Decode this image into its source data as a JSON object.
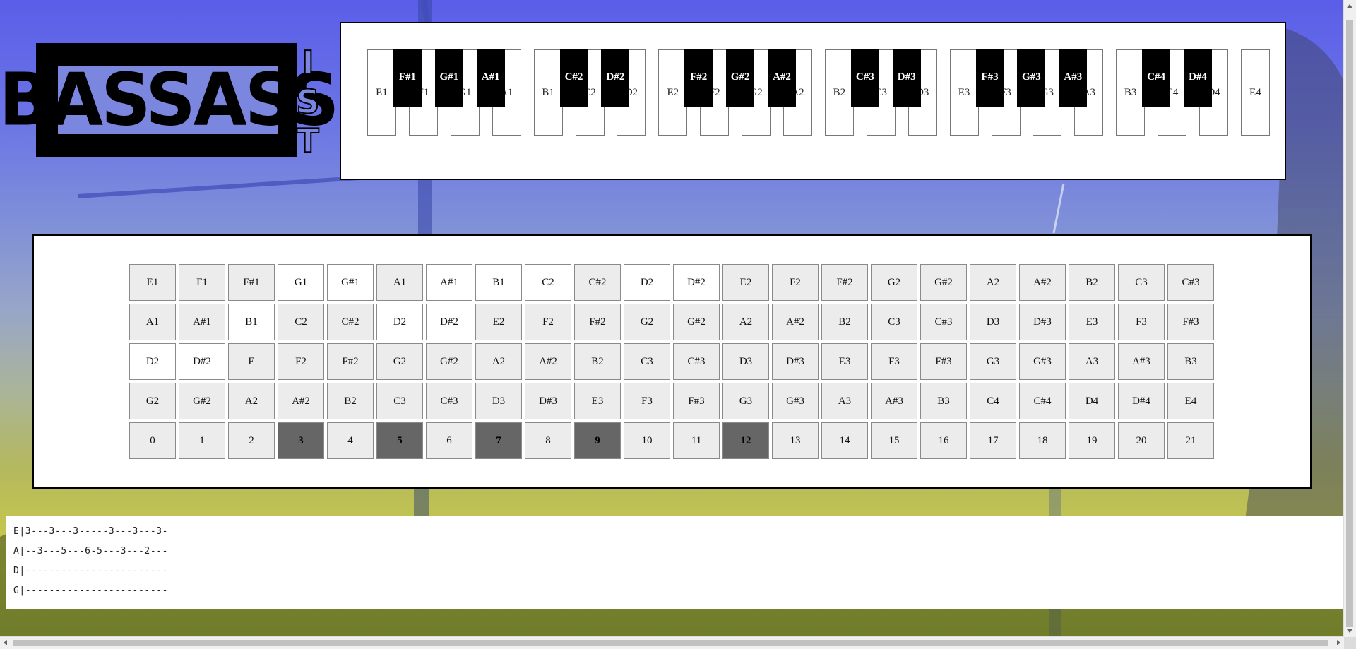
{
  "logo": {
    "main": "BASSASS",
    "side": [
      "I",
      "S",
      "T"
    ]
  },
  "piano": {
    "white_keys": [
      "E1",
      "F1",
      "G1",
      "A1",
      "B1",
      "C2",
      "D2",
      "E2",
      "F2",
      "G2",
      "A2",
      "B2",
      "C3",
      "D3",
      "E3",
      "F3",
      "G3",
      "A3",
      "B3",
      "C4",
      "D4",
      "E4"
    ],
    "black_keys": [
      {
        "label": "F#1",
        "after": 1
      },
      {
        "label": "G#1",
        "after": 2
      },
      {
        "label": "A#1",
        "after": 3
      },
      {
        "label": "C#2",
        "after": 5
      },
      {
        "label": "D#2",
        "after": 6
      },
      {
        "label": "F#2",
        "after": 8
      },
      {
        "label": "G#2",
        "after": 9
      },
      {
        "label": "A#2",
        "after": 10
      },
      {
        "label": "C#3",
        "after": 12
      },
      {
        "label": "D#3",
        "after": 13
      },
      {
        "label": "F#3",
        "after": 15
      },
      {
        "label": "G#3",
        "after": 16
      },
      {
        "label": "A#3",
        "after": 17
      },
      {
        "label": "C#4",
        "after": 19
      },
      {
        "label": "D#4",
        "after": 20
      }
    ]
  },
  "fretboard": {
    "strings": [
      {
        "name": "G",
        "cells": [
          "E1",
          "F1",
          "F#1",
          "G1",
          "G#1",
          "A1",
          "A#1",
          "B1",
          "C2",
          "C#2",
          "D2",
          "D#2",
          "E2",
          "F2",
          "F#2",
          "G2",
          "G#2",
          "A2",
          "A#2",
          "B2",
          "C3",
          "C#3"
        ],
        "white": [
          3,
          4,
          6,
          7,
          8,
          10,
          11
        ]
      },
      {
        "name": "D",
        "cells": [
          "A1",
          "A#1",
          "B1",
          "C2",
          "C#2",
          "D2",
          "D#2",
          "E2",
          "F2",
          "F#2",
          "G2",
          "G#2",
          "A2",
          "A#2",
          "B2",
          "C3",
          "C#3",
          "D3",
          "D#3",
          "E3",
          "F3",
          "F#3"
        ],
        "white": [
          2,
          5,
          6
        ]
      },
      {
        "name": "A",
        "cells": [
          "D2",
          "D#2",
          "E",
          "F2",
          "F#2",
          "G2",
          "G#2",
          "A2",
          "A#2",
          "B2",
          "C3",
          "C#3",
          "D3",
          "D#3",
          "E3",
          "F3",
          "F#3",
          "G3",
          "G#3",
          "A3",
          "A#3",
          "B3"
        ],
        "white": [
          0,
          1
        ]
      },
      {
        "name": "E",
        "cells": [
          "G2",
          "G#2",
          "A2",
          "A#2",
          "B2",
          "C3",
          "C#3",
          "D3",
          "D#3",
          "E3",
          "F3",
          "F#3",
          "G3",
          "G#3",
          "A3",
          "A#3",
          "B3",
          "C4",
          "C#4",
          "D4",
          "D#4",
          "E4"
        ],
        "white": []
      }
    ],
    "frets": [
      "0",
      "1",
      "2",
      "3",
      "4",
      "5",
      "6",
      "7",
      "8",
      "9",
      "10",
      "11",
      "12",
      "13",
      "14",
      "15",
      "16",
      "17",
      "18",
      "19",
      "20",
      "21"
    ],
    "marked_frets": [
      3,
      5,
      7,
      9,
      12
    ]
  },
  "tab": [
    "E|3---3---3-----3---3---3-",
    "A|--3---5---6-5---3---2---",
    "D|------------------------",
    "G|------------------------"
  ]
}
